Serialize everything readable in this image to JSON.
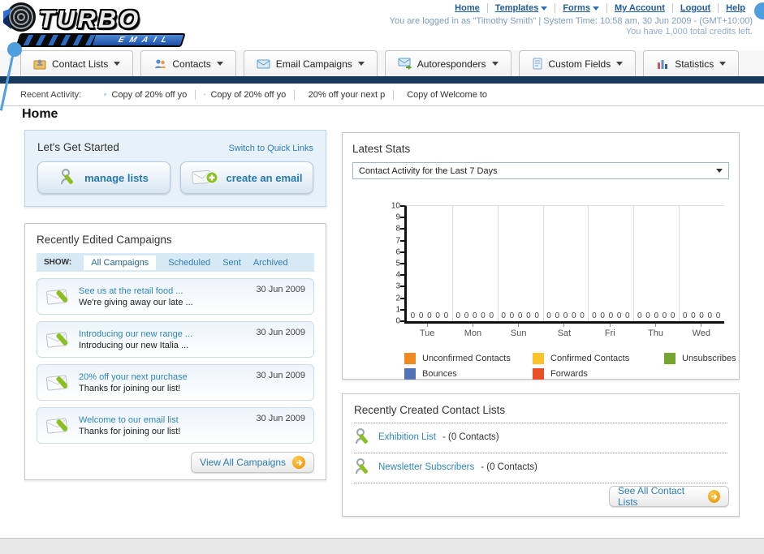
{
  "brand": {
    "name_top": "TURBO",
    "name_bottom": "EMAIL"
  },
  "header": {
    "links": [
      {
        "label": "Home",
        "has_dropdown": false
      },
      {
        "label": "Templates",
        "has_dropdown": true
      },
      {
        "label": "Forms",
        "has_dropdown": true
      },
      {
        "label": "My Account",
        "has_dropdown": false
      },
      {
        "label": "Logout",
        "has_dropdown": false
      },
      {
        "label": "Help",
        "has_dropdown": false
      }
    ],
    "status_line1": "You are logged in as \"Timothy Smith\" | System Time: 10:58 am, 30 Jun 2009 - (GMT+10:00)",
    "status_line2": "You have 1,000 total credits left."
  },
  "nav": {
    "tabs": [
      {
        "label": "Contact Lists",
        "icon": "contact-lists-icon"
      },
      {
        "label": "Contacts",
        "icon": "contacts-icon"
      },
      {
        "label": "Email Campaigns",
        "icon": "email-campaigns-icon"
      },
      {
        "label": "Autoresponders",
        "icon": "autoresponders-icon"
      },
      {
        "label": "Custom Fields",
        "icon": "custom-fields-icon"
      },
      {
        "label": "Statistics",
        "icon": "statistics-icon"
      }
    ]
  },
  "recent_activity": {
    "label": "Recent Activity:",
    "items": [
      "Copy of 20% off yo",
      "Copy of 20% off yo",
      "20% off your next p",
      "Copy of Welcome to"
    ]
  },
  "home": {
    "title": "Home"
  },
  "get_started": {
    "title": "Let's Get Started",
    "switch_link": "Switch to Quick Links",
    "manage_lists_label": "manage lists",
    "create_email_label": "create an email"
  },
  "campaigns": {
    "title": "Recently Edited Campaigns",
    "filter_label": "SHOW:",
    "filters": [
      {
        "label": "All Campaigns",
        "active": true
      },
      {
        "label": "Scheduled",
        "active": false
      },
      {
        "label": "Sent",
        "active": false
      },
      {
        "label": "Archived",
        "active": false
      }
    ],
    "items": [
      {
        "title": "See us at the retail food ...",
        "subtitle": "We're giving away our late ...",
        "date": "30 Jun 2009"
      },
      {
        "title": "Introducing our new range ...",
        "subtitle": "Introducing our new Italia ...",
        "date": "30 Jun 2009"
      },
      {
        "title": "20% off your next purchase",
        "subtitle": "Thanks for joining our list!",
        "date": "30 Jun 2009"
      },
      {
        "title": "Welcome to our email list",
        "subtitle": "Thanks for joining our list!",
        "date": "30 Jun 2009"
      }
    ],
    "view_all_label": "View All Campaigns"
  },
  "latest_stats": {
    "title": "Latest Stats",
    "selected_option": "Contact Activity for the Last 7 Days"
  },
  "chart_data": {
    "type": "bar",
    "title": "Contact Activity for the Last 7 Days",
    "categories": [
      "Tue",
      "Mon",
      "Sun",
      "Sat",
      "Fri",
      "Thu",
      "Wed"
    ],
    "series": [
      {
        "name": "Unconfirmed Contacts",
        "color": "#f0891f",
        "values": [
          0,
          0,
          0,
          0,
          0,
          0,
          0
        ]
      },
      {
        "name": "Confirmed Contacts",
        "color": "#fbc32a",
        "values": [
          0,
          0,
          0,
          0,
          0,
          0,
          0
        ]
      },
      {
        "name": "Unsubscribes",
        "color": "#74a52f",
        "values": [
          0,
          0,
          0,
          0,
          0,
          0,
          0
        ]
      },
      {
        "name": "Bounces",
        "color": "#5272b4",
        "values": [
          0,
          0,
          0,
          0,
          0,
          0,
          0
        ]
      },
      {
        "name": "Forwards",
        "color": "#e84e27",
        "values": [
          0,
          0,
          0,
          0,
          0,
          0,
          0
        ]
      }
    ],
    "xlabel": "",
    "ylabel": "",
    "ylim": [
      0,
      10
    ],
    "yticks": [
      0,
      1,
      2,
      3,
      4,
      5,
      6,
      7,
      8,
      9,
      10
    ],
    "grid": "vertical-only",
    "legend_position": "bottom"
  },
  "contact_lists": {
    "title": "Recently Created Contact Lists",
    "items": [
      {
        "name": "Exhibition List",
        "detail": "- (0 Contacts)"
      },
      {
        "name": "Newsletter Subscribers",
        "detail": "- (0 Contacts)"
      }
    ],
    "see_all_label": "See All Contact Lists"
  },
  "colors": {
    "navy_bar": "#17395c",
    "link_blue": "#2d7db3",
    "header_link_blue": "#1f5c9e",
    "accent_orange": "#e89000",
    "panel_blue_bg": "#e7f1f9",
    "decorative_dot_blue": "#4f9ede"
  }
}
